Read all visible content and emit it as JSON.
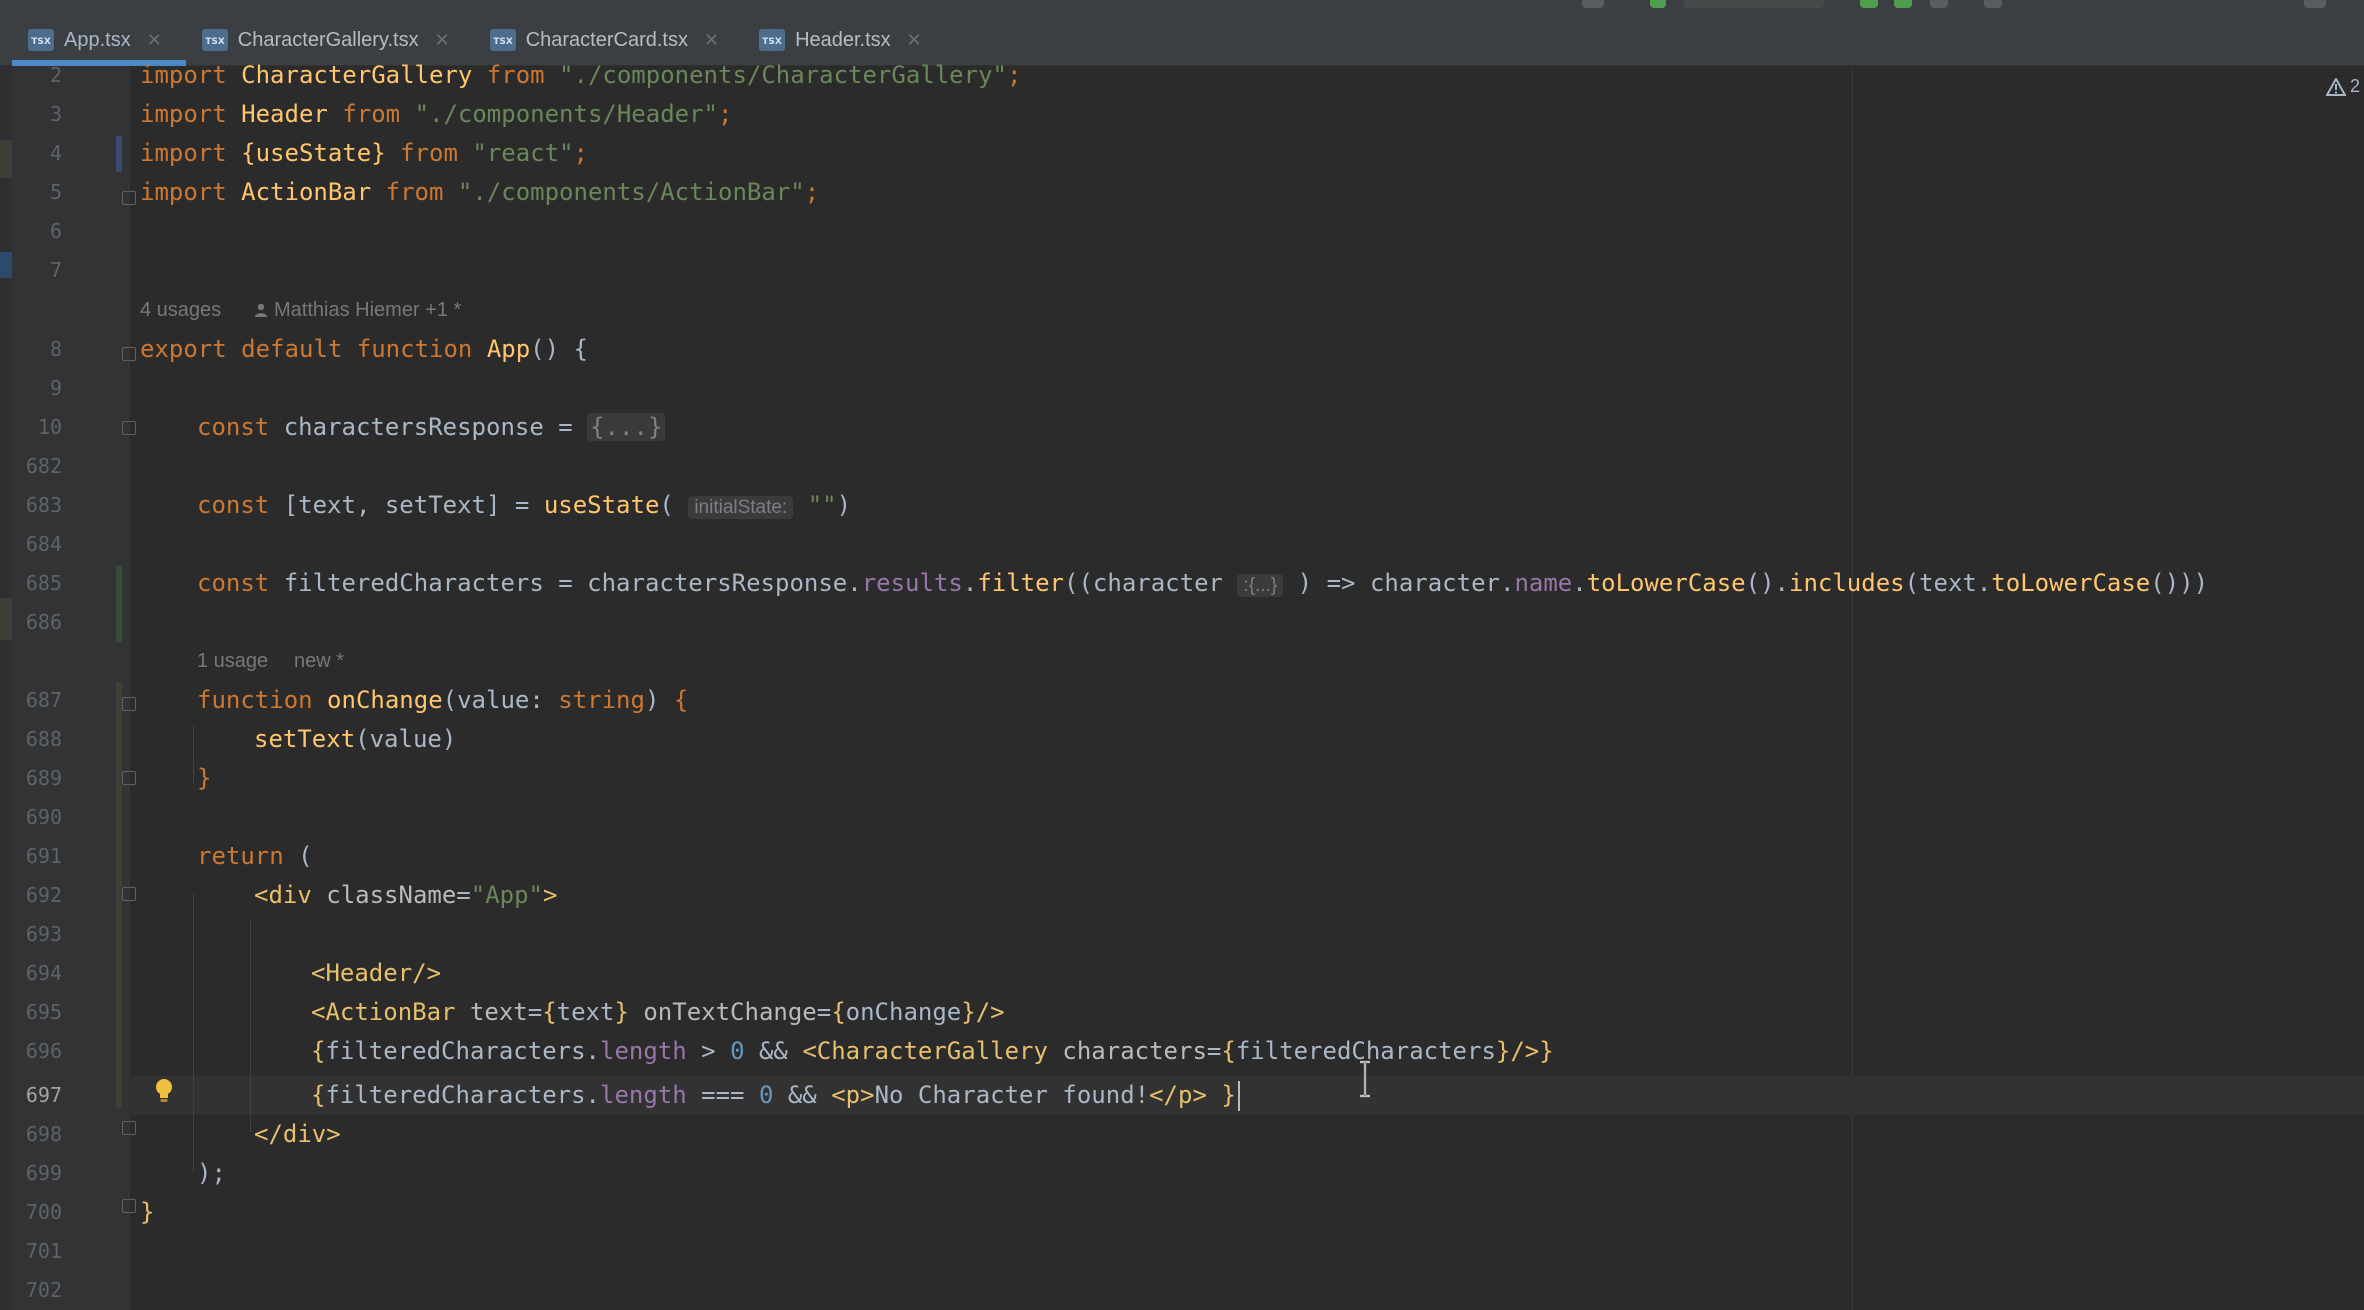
{
  "tabs": [
    {
      "label": "App.tsx",
      "active": true
    },
    {
      "label": "CharacterGallery.tsx",
      "active": false
    },
    {
      "label": "CharacterCard.tsx",
      "active": false
    },
    {
      "label": "Header.tsx",
      "active": false
    }
  ],
  "tab_icon_text": "TSX",
  "warnings": {
    "count": "2"
  },
  "line_numbers": [
    "2",
    "3",
    "4",
    "5",
    "6",
    "7",
    "8",
    "9",
    "10",
    "682",
    "683",
    "684",
    "685",
    "686",
    "687",
    "688",
    "689",
    "690",
    "691",
    "692",
    "693",
    "694",
    "695",
    "696",
    "697",
    "698",
    "699",
    "700",
    "701",
    "702"
  ],
  "current_line": "697",
  "inlays": {
    "usages1": "4 usages",
    "author": "Matthias Hiemer +1 *",
    "usages2": "1 usage",
    "new_label": "new *",
    "hint_initial_state": "initialState:",
    "hint_character_type": ":{...}"
  },
  "code": {
    "import": "import",
    "from": "from",
    "export": "export",
    "default": "default",
    "function": "function",
    "const": "const",
    "return": "return",
    "string_type": "string",
    "l2_name": "CharacterGallery",
    "l2_path": "\"./components/CharacterGallery\"",
    "l3_name": "Header",
    "l3_path": "\"./components/Header\"",
    "l4_name": "{useState}",
    "l4_path": "\"react\"",
    "l5_name": "ActionBar",
    "l5_path": "\"./components/ActionBar\"",
    "app_fn": "App",
    "chars_response": "charactersResponse",
    "folded": "{...}",
    "text_state": "[text, setText]",
    "use_state": "useState",
    "empty_str": "\"\"",
    "filtered": "filteredCharacters",
    "results": "results",
    "filter": "filter",
    "character": "character",
    "name": "name",
    "to_lower": "toLowerCase",
    "includes": "includes",
    "text": "text",
    "on_change": "onChange",
    "value_param": "value",
    "set_text": "setText",
    "value": "value",
    "div_open": "<div",
    "class_name": "className",
    "app_class": "\"App\"",
    "header_tag": "<Header/>",
    "action_bar_open": "<ActionBar",
    "text_attr": "text",
    "on_text_change": "onTextChange",
    "length": "length",
    "zero": "0",
    "gallery_tag": "<CharacterGallery",
    "characters_attr": "characters",
    "p_open": "<p>",
    "p_text": "No Character found!",
    "p_close": "</p>",
    "div_close": "</div>"
  }
}
